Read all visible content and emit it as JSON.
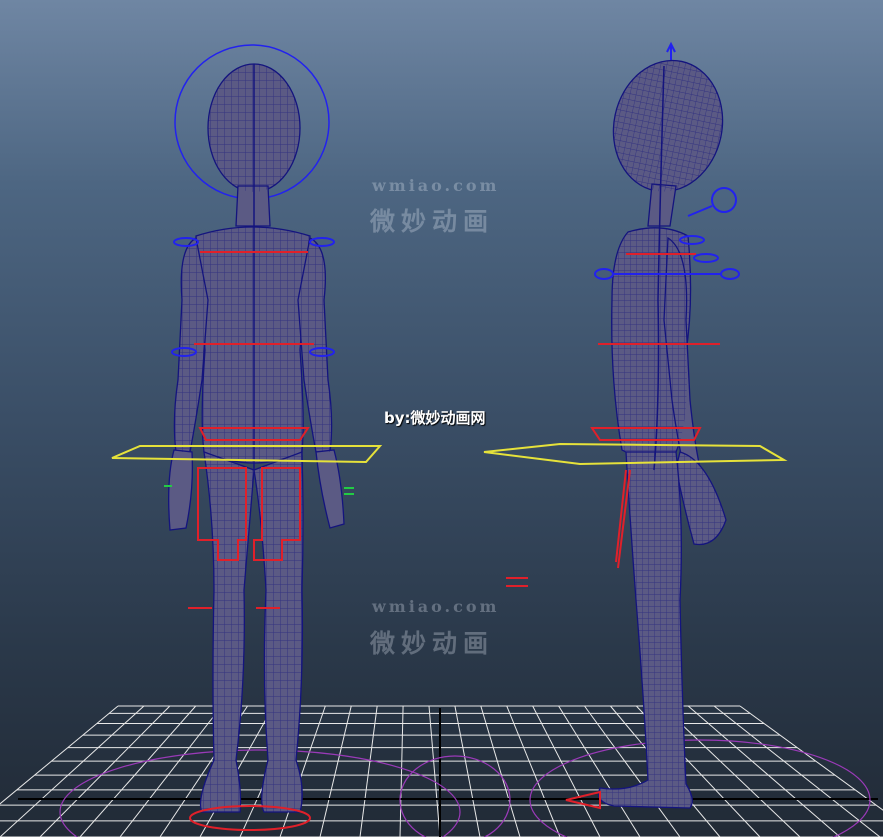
{
  "viewport": {
    "credit": "by:微妙动画网",
    "watermark_url": "wmiao.com",
    "watermark_cn": "微妙动画"
  },
  "colors": {
    "mesh_fill": "#5b5a84",
    "wireframe": "#14147e",
    "ik_controls": "#e0202a",
    "fk_controls": "#2222ee",
    "root_control": "#e6e23a",
    "finger_controls": "#22cc44",
    "grid": "#e8e8e8",
    "grid_axis": "#000000",
    "pole_circle": "#9a3ab8"
  }
}
